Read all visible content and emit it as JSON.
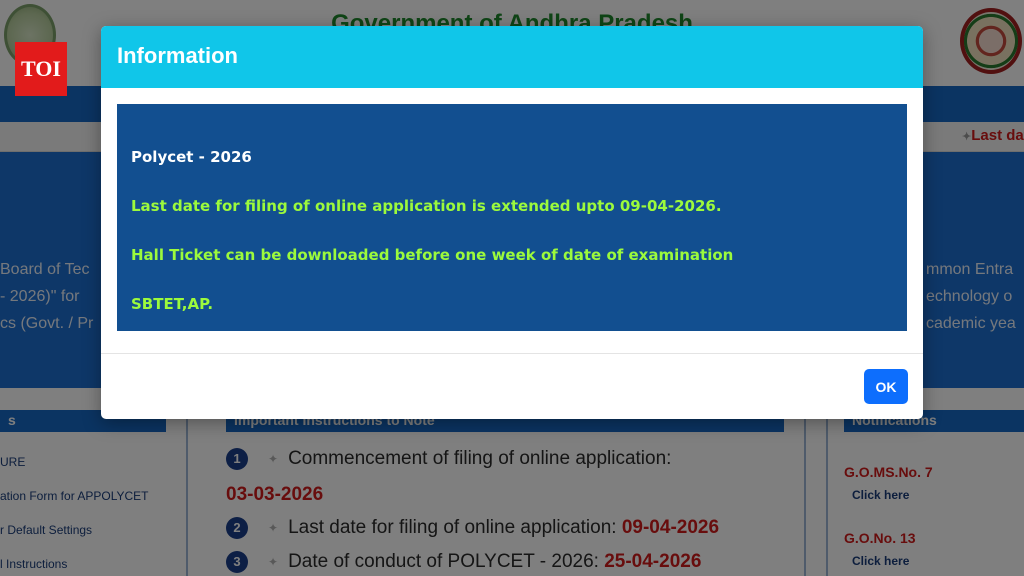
{
  "header": {
    "title": "Government of Andhra Pradesh",
    "badge": "TOI"
  },
  "ticker": {
    "text": "Last date"
  },
  "hero": {
    "left_lines": [
      "Board of Tec",
      "- 2026)\" for",
      "cs (Govt. / Pr"
    ],
    "right_lines": [
      "mmon Entra",
      "echnology o",
      "cademic yea"
    ]
  },
  "sidebar_left": {
    "heading": "s",
    "links": [
      "URE",
      "ation Form for APPOLYCET",
      "r Default Settings",
      "l Instructions"
    ]
  },
  "instructions": {
    "heading": "Important Instructions to Note",
    "items": [
      {
        "num": "1",
        "text": "Commencement of filing of online application:",
        "value": "03-03-2026"
      },
      {
        "num": "2",
        "text": "Last date for filing of online application:",
        "value": "09-04-2026"
      },
      {
        "num": "3",
        "text": "Date of conduct of POLYCET - 2026:",
        "value": "25-04-2026"
      }
    ]
  },
  "notifications": {
    "heading": "Notifications",
    "items": [
      {
        "title": "G.O.MS.No. 7",
        "link": "Click here"
      },
      {
        "title": "G.O.No. 13",
        "link": "Click here"
      }
    ]
  },
  "modal": {
    "title": "Information",
    "heading": "Polycet - 2026",
    "lines": [
      "Last date for filing of online application is extended upto 09-04-2026.",
      "Hall Ticket can be downloaded before one week of date of examination",
      "SBTET,AP."
    ],
    "ok_label": "OK"
  },
  "colors": {
    "modal_header": "#10c6e9",
    "modal_body": "#124f90",
    "message_green": "#9cfa3c",
    "ok_button": "#0d6efd",
    "highlight_red": "#d11b1b"
  }
}
